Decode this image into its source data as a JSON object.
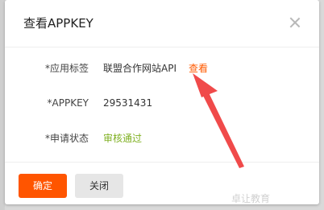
{
  "dialog": {
    "title": "查看APPKEY",
    "close_icon": "close-icon"
  },
  "fields": [
    {
      "label": "*应用标签",
      "value": "联盟合作网站API",
      "link": "查看"
    },
    {
      "label": "*APPKEY",
      "value": "29531431"
    },
    {
      "label": "*申请状态",
      "value": "审核通过"
    }
  ],
  "footer": {
    "confirm_label": "确定",
    "close_label": "关闭"
  },
  "colors": {
    "accent": "#ff5500",
    "link": "#ff5a00",
    "status_ok": "#7fb022",
    "annotation_arrow": "#f04a4a"
  },
  "watermark": "卓让教育"
}
